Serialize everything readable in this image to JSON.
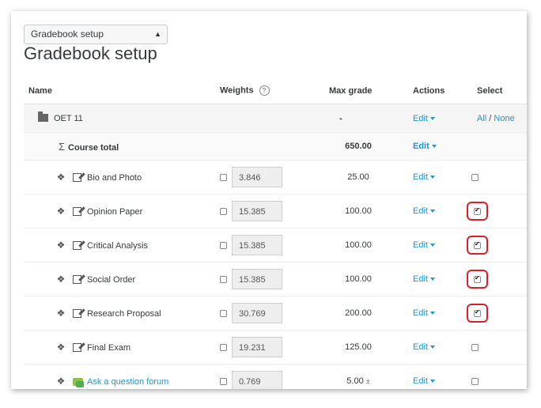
{
  "setup_select": {
    "value": "Gradebook setup"
  },
  "page_title": "Gradebook setup",
  "columns": {
    "name": "Name",
    "weights": "Weights",
    "max_grade": "Max grade",
    "actions": "Actions",
    "select": "Select"
  },
  "category": {
    "name": "OET 11",
    "max_grade": "-",
    "edit": "Edit",
    "select_all": "All",
    "separator": " / ",
    "select_none": "None"
  },
  "total": {
    "name": "Course total",
    "max_grade": "650.00",
    "edit": "Edit"
  },
  "items": [
    {
      "name": "Bio and Photo",
      "weight": "3.846",
      "max_grade": "25.00",
      "edit": "Edit",
      "selected": false
    },
    {
      "name": "Opinion Paper",
      "weight": "15.385",
      "max_grade": "100.00",
      "edit": "Edit",
      "selected": true
    },
    {
      "name": "Critical Analysis",
      "weight": "15.385",
      "max_grade": "100.00",
      "edit": "Edit",
      "selected": true
    },
    {
      "name": "Social Order",
      "weight": "15.385",
      "max_grade": "100.00",
      "edit": "Edit",
      "selected": true
    },
    {
      "name": "Research Proposal",
      "weight": "30.769",
      "max_grade": "200.00",
      "edit": "Edit",
      "selected": true
    },
    {
      "name": "Final Exam",
      "weight": "19.231",
      "max_grade": "125.00",
      "edit": "Edit",
      "selected": false
    },
    {
      "name": "Ask a question forum",
      "weight": "0.769",
      "max_grade": "5.00",
      "max_grade_suffix": "±",
      "edit": "Edit",
      "selected": false,
      "is_link": true
    }
  ],
  "colors": {
    "link": "#1e96d1",
    "highlight": "#d9202a"
  }
}
